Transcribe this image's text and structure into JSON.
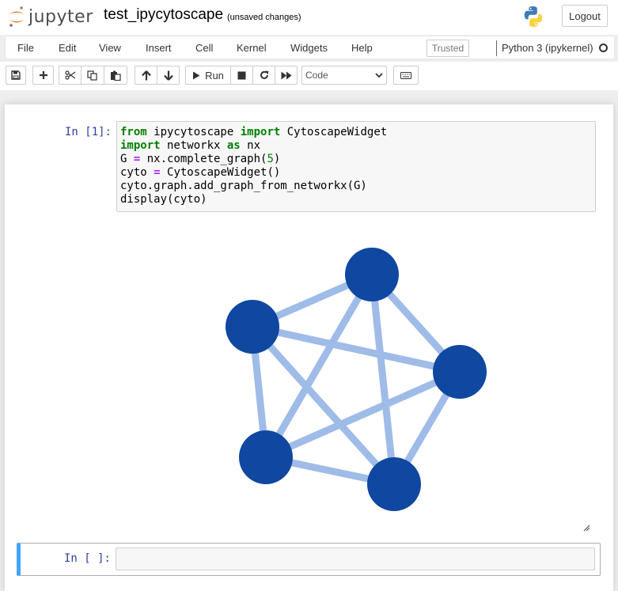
{
  "header": {
    "logo_text": "jupyter",
    "notebook_name": "test_ipycytoscape",
    "save_status": "(unsaved changes)",
    "logout_label": "Logout"
  },
  "menubar": {
    "items": [
      "File",
      "Edit",
      "View",
      "Insert",
      "Cell",
      "Kernel",
      "Widgets",
      "Help"
    ],
    "trusted_label": "Trusted",
    "kernel_name": "Python 3 (ipykernel)"
  },
  "toolbar": {
    "run_label": "Run",
    "cell_type": "Code",
    "icons": [
      "save-icon",
      "plus-icon",
      "scissors-icon",
      "copy-icon",
      "paste-icon",
      "arrow-up-icon",
      "arrow-down-icon",
      "play-icon",
      "stop-icon",
      "restart-icon",
      "fast-forward-icon",
      "keyboard-icon"
    ]
  },
  "cells": [
    {
      "prompt": "In [1]:",
      "code_lines": [
        [
          {
            "t": "from",
            "c": "kw"
          },
          {
            "t": " ipycytoscape ",
            "c": ""
          },
          {
            "t": "import",
            "c": "kw"
          },
          {
            "t": " CytoscapeWidget",
            "c": ""
          }
        ],
        [
          {
            "t": "import",
            "c": "kw"
          },
          {
            "t": " networkx ",
            "c": ""
          },
          {
            "t": "as",
            "c": "kw"
          },
          {
            "t": " nx",
            "c": ""
          }
        ],
        [
          {
            "t": "G ",
            "c": ""
          },
          {
            "t": "=",
            "c": "op"
          },
          {
            "t": " nx.complete_graph(",
            "c": ""
          },
          {
            "t": "5",
            "c": "num"
          },
          {
            "t": ")",
            "c": ""
          }
        ],
        [
          {
            "t": "cyto ",
            "c": ""
          },
          {
            "t": "=",
            "c": "op"
          },
          {
            "t": " CytoscapeWidget()",
            "c": ""
          }
        ],
        [
          {
            "t": "cyto.graph.add_graph_from_networkx(G)",
            "c": ""
          }
        ],
        [
          {
            "t": "display(cyto)",
            "c": ""
          }
        ]
      ]
    },
    {
      "prompt": "In [ ]:"
    }
  ],
  "graph": {
    "node_color": "#0f47a1",
    "edge_color": "#9fbbe8",
    "nodes": [
      "0",
      "1",
      "2",
      "3",
      "4"
    ],
    "edges": [
      [
        "0",
        "1"
      ],
      [
        "0",
        "2"
      ],
      [
        "0",
        "3"
      ],
      [
        "0",
        "4"
      ],
      [
        "1",
        "2"
      ],
      [
        "1",
        "3"
      ],
      [
        "1",
        "4"
      ],
      [
        "2",
        "3"
      ],
      [
        "2",
        "4"
      ],
      [
        "3",
        "4"
      ]
    ]
  }
}
